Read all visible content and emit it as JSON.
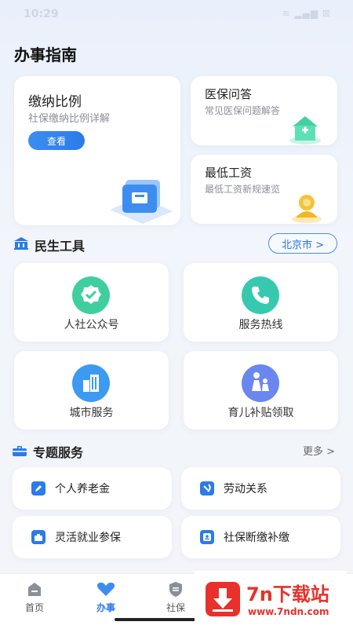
{
  "status": {
    "time": "10:29",
    "icons": "≋ ▂▄▆ ⊠"
  },
  "page_title": "办事指南",
  "guide": {
    "big_card": {
      "title": "缴纳比例",
      "subtitle": "社保缴纳比例详解",
      "button": "查看"
    },
    "cards": [
      {
        "title": "医保问答",
        "subtitle": "常见医保问题解答"
      },
      {
        "title": "最低工资",
        "subtitle": "最低工资新规速览"
      }
    ]
  },
  "tools": {
    "title": "民生工具",
    "city": "北京市 >",
    "items": [
      {
        "label": "人社公众号",
        "icon": "verified-badge-icon",
        "color": "#3fcf9f"
      },
      {
        "label": "服务热线",
        "icon": "phone-icon",
        "color": "#36c9b0"
      },
      {
        "label": "城市服务",
        "icon": "buildings-icon",
        "color": "#3d9af2"
      },
      {
        "label": "育儿补贴领取",
        "icon": "family-icon",
        "color": "#6a86ef"
      }
    ]
  },
  "services": {
    "title": "专题服务",
    "more": "更多 >",
    "items": [
      {
        "label": "个人养老金",
        "icon": "pen-icon"
      },
      {
        "label": "劳动关系",
        "icon": "hammer-sickle-icon"
      },
      {
        "label": "灵活就业参保",
        "icon": "briefcase-icon"
      },
      {
        "label": "社保断缴补缴",
        "icon": "id-card-icon"
      }
    ]
  },
  "nav": [
    {
      "label": "首页",
      "icon": "home-icon",
      "active": false
    },
    {
      "label": "办事",
      "icon": "heart-icon",
      "active": true
    },
    {
      "label": "社保",
      "icon": "shield-icon",
      "active": false
    }
  ],
  "watermark": {
    "brand": "7n下载站",
    "url": "www.7ndn.com"
  },
  "colors": {
    "accent": "#2b7be8",
    "watermark_red": "#e8312a"
  }
}
